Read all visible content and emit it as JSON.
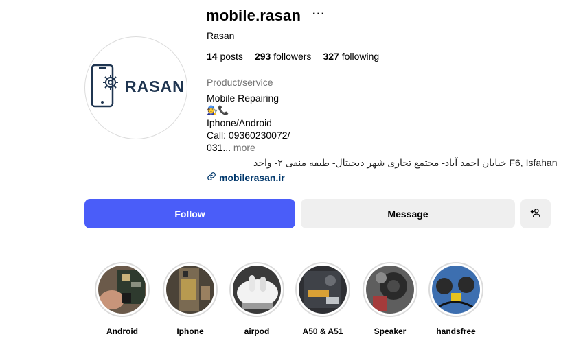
{
  "profile": {
    "username": "mobile.rasan",
    "more_icon": "more-horizontal-icon",
    "full_name": "Rasan",
    "avatar_text": "RASAN",
    "stats": [
      {
        "count": "14",
        "label": "posts"
      },
      {
        "count": "293",
        "label": "followers"
      },
      {
        "count": "327",
        "label": "following"
      }
    ],
    "category": "Product/service",
    "bio": {
      "line1": "Mobile Repairing",
      "emoji_line": "🧑‍🔧📞",
      "line3": "Iphone/Android",
      "line4": "Call: 09360230072/",
      "line5": "031...",
      "more": "more"
    },
    "address": "خیابان احمد آباد- مجتمع تجاری شهر دیجیتال- طبقه منفی ۲- واحد F6, Isfahan",
    "website": "mobilerasan.ir",
    "link_icon": "link-icon"
  },
  "actions": {
    "follow": "Follow",
    "message": "Message",
    "add_user_icon": "add-user-icon"
  },
  "highlights": [
    {
      "label": "Android"
    },
    {
      "label": "Iphone"
    },
    {
      "label": "airpod"
    },
    {
      "label": "A50 & A51"
    },
    {
      "label": "Speaker"
    },
    {
      "label": "handsfree"
    }
  ],
  "colors": {
    "follow_button": "#4a5df9",
    "secondary_button": "#efefef",
    "link": "#00376b",
    "brand_navy": "#1f3550"
  }
}
